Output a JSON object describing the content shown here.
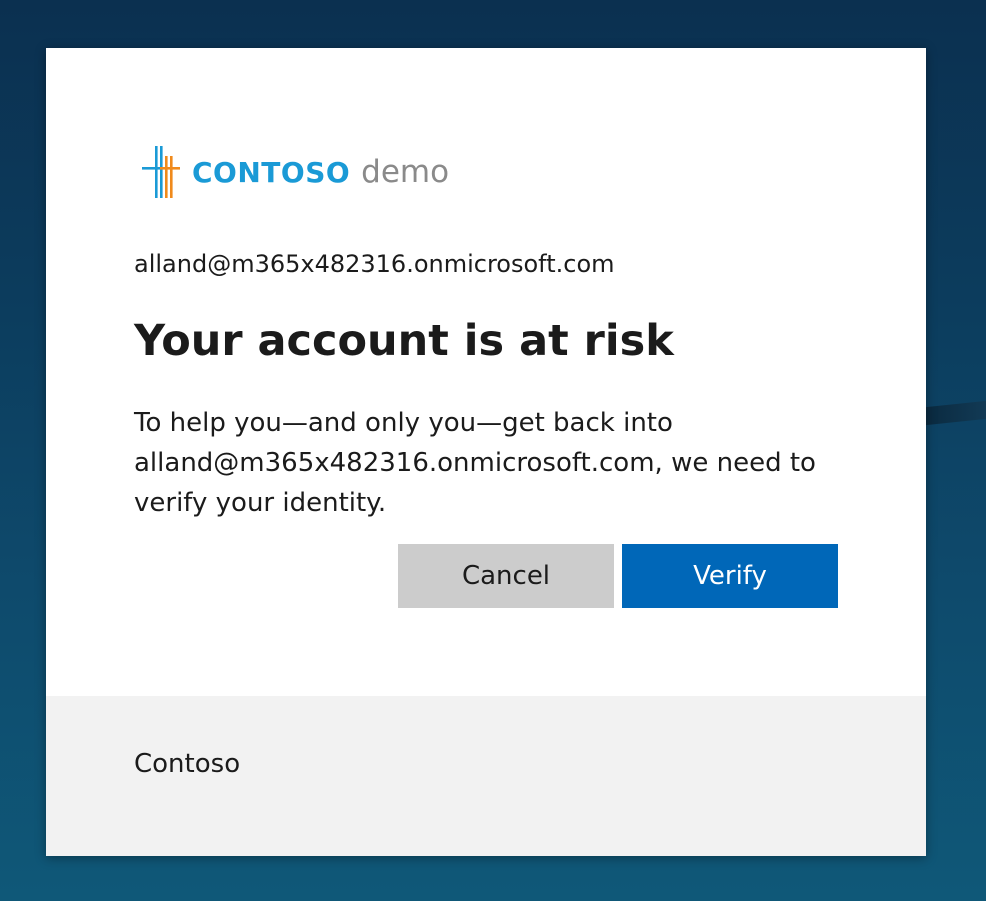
{
  "brand": {
    "name": "CONTOSO",
    "suffix": "demo",
    "primary_color": "#1a9ad6",
    "accent_color": "#f08a1c",
    "suffix_color": "#8a8a8a"
  },
  "account": {
    "email": "alland@m365x482316.onmicrosoft.com"
  },
  "dialog": {
    "title": "Your account is at risk",
    "description": "To help you—and only you—get back into alland@m365x482316.onmicrosoft.com, we need to verify your identity."
  },
  "buttons": {
    "cancel_label": "Cancel",
    "verify_label": "Verify",
    "verify_color": "#0067b8",
    "cancel_color": "#cccccc"
  },
  "footer": {
    "label": "Contoso"
  }
}
